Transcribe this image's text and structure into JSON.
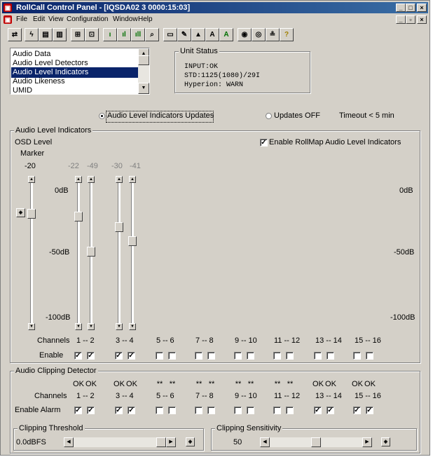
{
  "window": {
    "title": "RollCall Control Panel - [IQSDA02 3 0000:15:03]",
    "app_icon": "rollcall-app-icon",
    "controls": [
      "minimize",
      "maximize",
      "close"
    ]
  },
  "menu": [
    "File",
    "Edit",
    "View",
    "Configuration",
    "Window",
    "Help"
  ],
  "toolbar": {
    "icons": [
      "disconnect-icon",
      "lightning-icon",
      "save-icon",
      "load-icon",
      "network-icon",
      "device-icon",
      "audio-bars-1-icon",
      "audio-bars-2-icon",
      "audio-bars-3-icon",
      "audio-search-icon",
      "display-icon",
      "edit-display-icon",
      "lock-icon",
      "text-a-icon",
      "text-a-green-icon",
      "search-settings-icon",
      "eye-icon",
      "log-icon",
      "help-icon"
    ],
    "labels": {
      "a1": "A",
      "a2": "A",
      "help": "?"
    }
  },
  "list": {
    "items": [
      "Audio Data",
      "Audio Level Detectors",
      "Audio Level Indicators",
      "Audio Likeness",
      "UMID"
    ],
    "selected_index": 2
  },
  "unit_status": {
    "title": "Unit Status",
    "lines": [
      "INPUT:OK",
      "STD:1125(1080)/29I",
      "Hyperion: WARN"
    ]
  },
  "updates": {
    "option_on": "Audio Level Indicators Updates",
    "option_off": "Updates OFF",
    "selected": "on",
    "timeout": "Timeout < 5 min"
  },
  "ali": {
    "group_title": "Audio Level Indicators",
    "osd_level_label": "OSD Level",
    "marker_label": "Marker",
    "enable_rollmap_label": "Enable RollMap Audio Level Indicators",
    "enable_rollmap_checked": true,
    "osd_value": "-20",
    "channel_values": [
      "-22",
      "-49",
      "-30",
      "-41"
    ],
    "scale_left": [
      "0dB",
      "-50dB",
      "-100dB"
    ],
    "scale_right": [
      "0dB",
      "-50dB",
      "-100dB"
    ],
    "channels_label": "Channels",
    "enable_label": "Enable",
    "channel_pairs": [
      "1 -- 2",
      "3 -- 4",
      "5 -- 6",
      "7 -- 8",
      "9 -- 10",
      "11 -- 12",
      "13 -- 14",
      "15 -- 16"
    ],
    "enable_checks": [
      true,
      true,
      true,
      true,
      false,
      false,
      false,
      false,
      false,
      false,
      false,
      false,
      false,
      false,
      false,
      false
    ],
    "osd_level_fraction": 0.2,
    "channel_levels_fraction": [
      0.22,
      0.49,
      0.3,
      0.41
    ],
    "reset_icon": "reset-marker-icon"
  },
  "clip": {
    "group_title": "Audio Clipping Detector",
    "status": [
      "OK",
      "OK",
      "OK",
      "OK",
      "**",
      "**",
      "**",
      "**",
      "**",
      "**",
      "**",
      "**",
      "OK",
      "OK",
      "OK",
      "OK"
    ],
    "channels_label": "Channels",
    "channel_pairs": [
      "1 -- 2",
      "3 -- 4",
      "5 -- 6",
      "7 -- 8",
      "9 -- 10",
      "11 -- 12",
      "13 -- 14",
      "15 -- 16"
    ],
    "enable_alarm_label": "Enable Alarm",
    "alarm_checks": [
      true,
      true,
      true,
      true,
      false,
      false,
      false,
      false,
      false,
      false,
      false,
      false,
      true,
      true,
      true,
      true
    ],
    "threshold_title": "Clipping Threshold",
    "threshold_value": "0.0dBFS",
    "threshold_fraction": 1.0,
    "sensitivity_title": "Clipping Sensitivity",
    "sensitivity_value": "50",
    "sensitivity_fraction": 0.5
  }
}
